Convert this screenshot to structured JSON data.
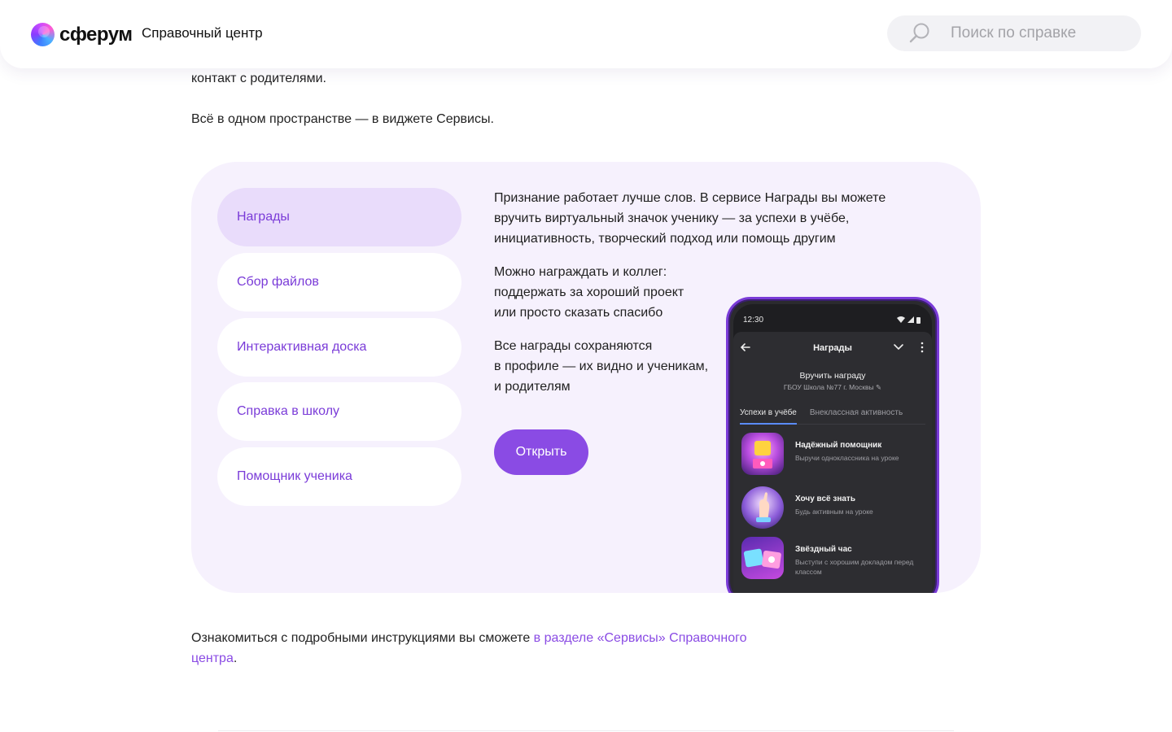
{
  "header": {
    "logo_text": "сферум",
    "title": "Справочный центр",
    "search_placeholder": "Поиск по справке"
  },
  "content": {
    "intro_tail": "контакт с родителями.",
    "intro_line": "Всё в одном пространстве — в виджете Сервисы."
  },
  "widget": {
    "tabs": [
      {
        "label": "Награды",
        "active": true
      },
      {
        "label": "Сбор файлов",
        "active": false
      },
      {
        "label": "Интерактивная доска",
        "active": false
      },
      {
        "label": "Справка в школу",
        "active": false
      },
      {
        "label": "Помощник ученика",
        "active": false
      }
    ],
    "paragraphs": [
      [
        "Признание работает лучше слов. В сервисе Награды вы можете",
        "вручить виртуальный значок ученику — за успехи в учёбе,",
        "инициативность, творческий подход или помощь другим"
      ],
      [
        "Можно награждать и коллег:",
        "поддержать за хороший проект",
        "или просто сказать спасибо"
      ],
      [
        "Все награды сохраняются",
        "в профиле — их видно и ученикам,",
        "и родителям"
      ]
    ],
    "open_button": "Открыть",
    "accent_color": "#8a4be4"
  },
  "phone": {
    "time": "12:30",
    "screen_title": "Награды",
    "subtitle": "Вручить награду",
    "school": "ГБОУ Школа №77 г. Москвы",
    "tabs": [
      "Успехи в учёбе",
      "Внеклассная активность"
    ],
    "awards": [
      {
        "title": "Надёжный помощник",
        "subtitle": "Выручи одноклассника на уроке"
      },
      {
        "title": "Хочу всё знать",
        "subtitle": "Будь активным на уроке"
      },
      {
        "title": "Звёздный час",
        "subtitle": "Выступи с хорошим докладом перед классом"
      }
    ]
  },
  "footer": {
    "text": "Ознакомиться с подробными инструкциями вы сможете ",
    "link_text": "в разделе «Сервисы» Справочного центра",
    "after": "."
  }
}
